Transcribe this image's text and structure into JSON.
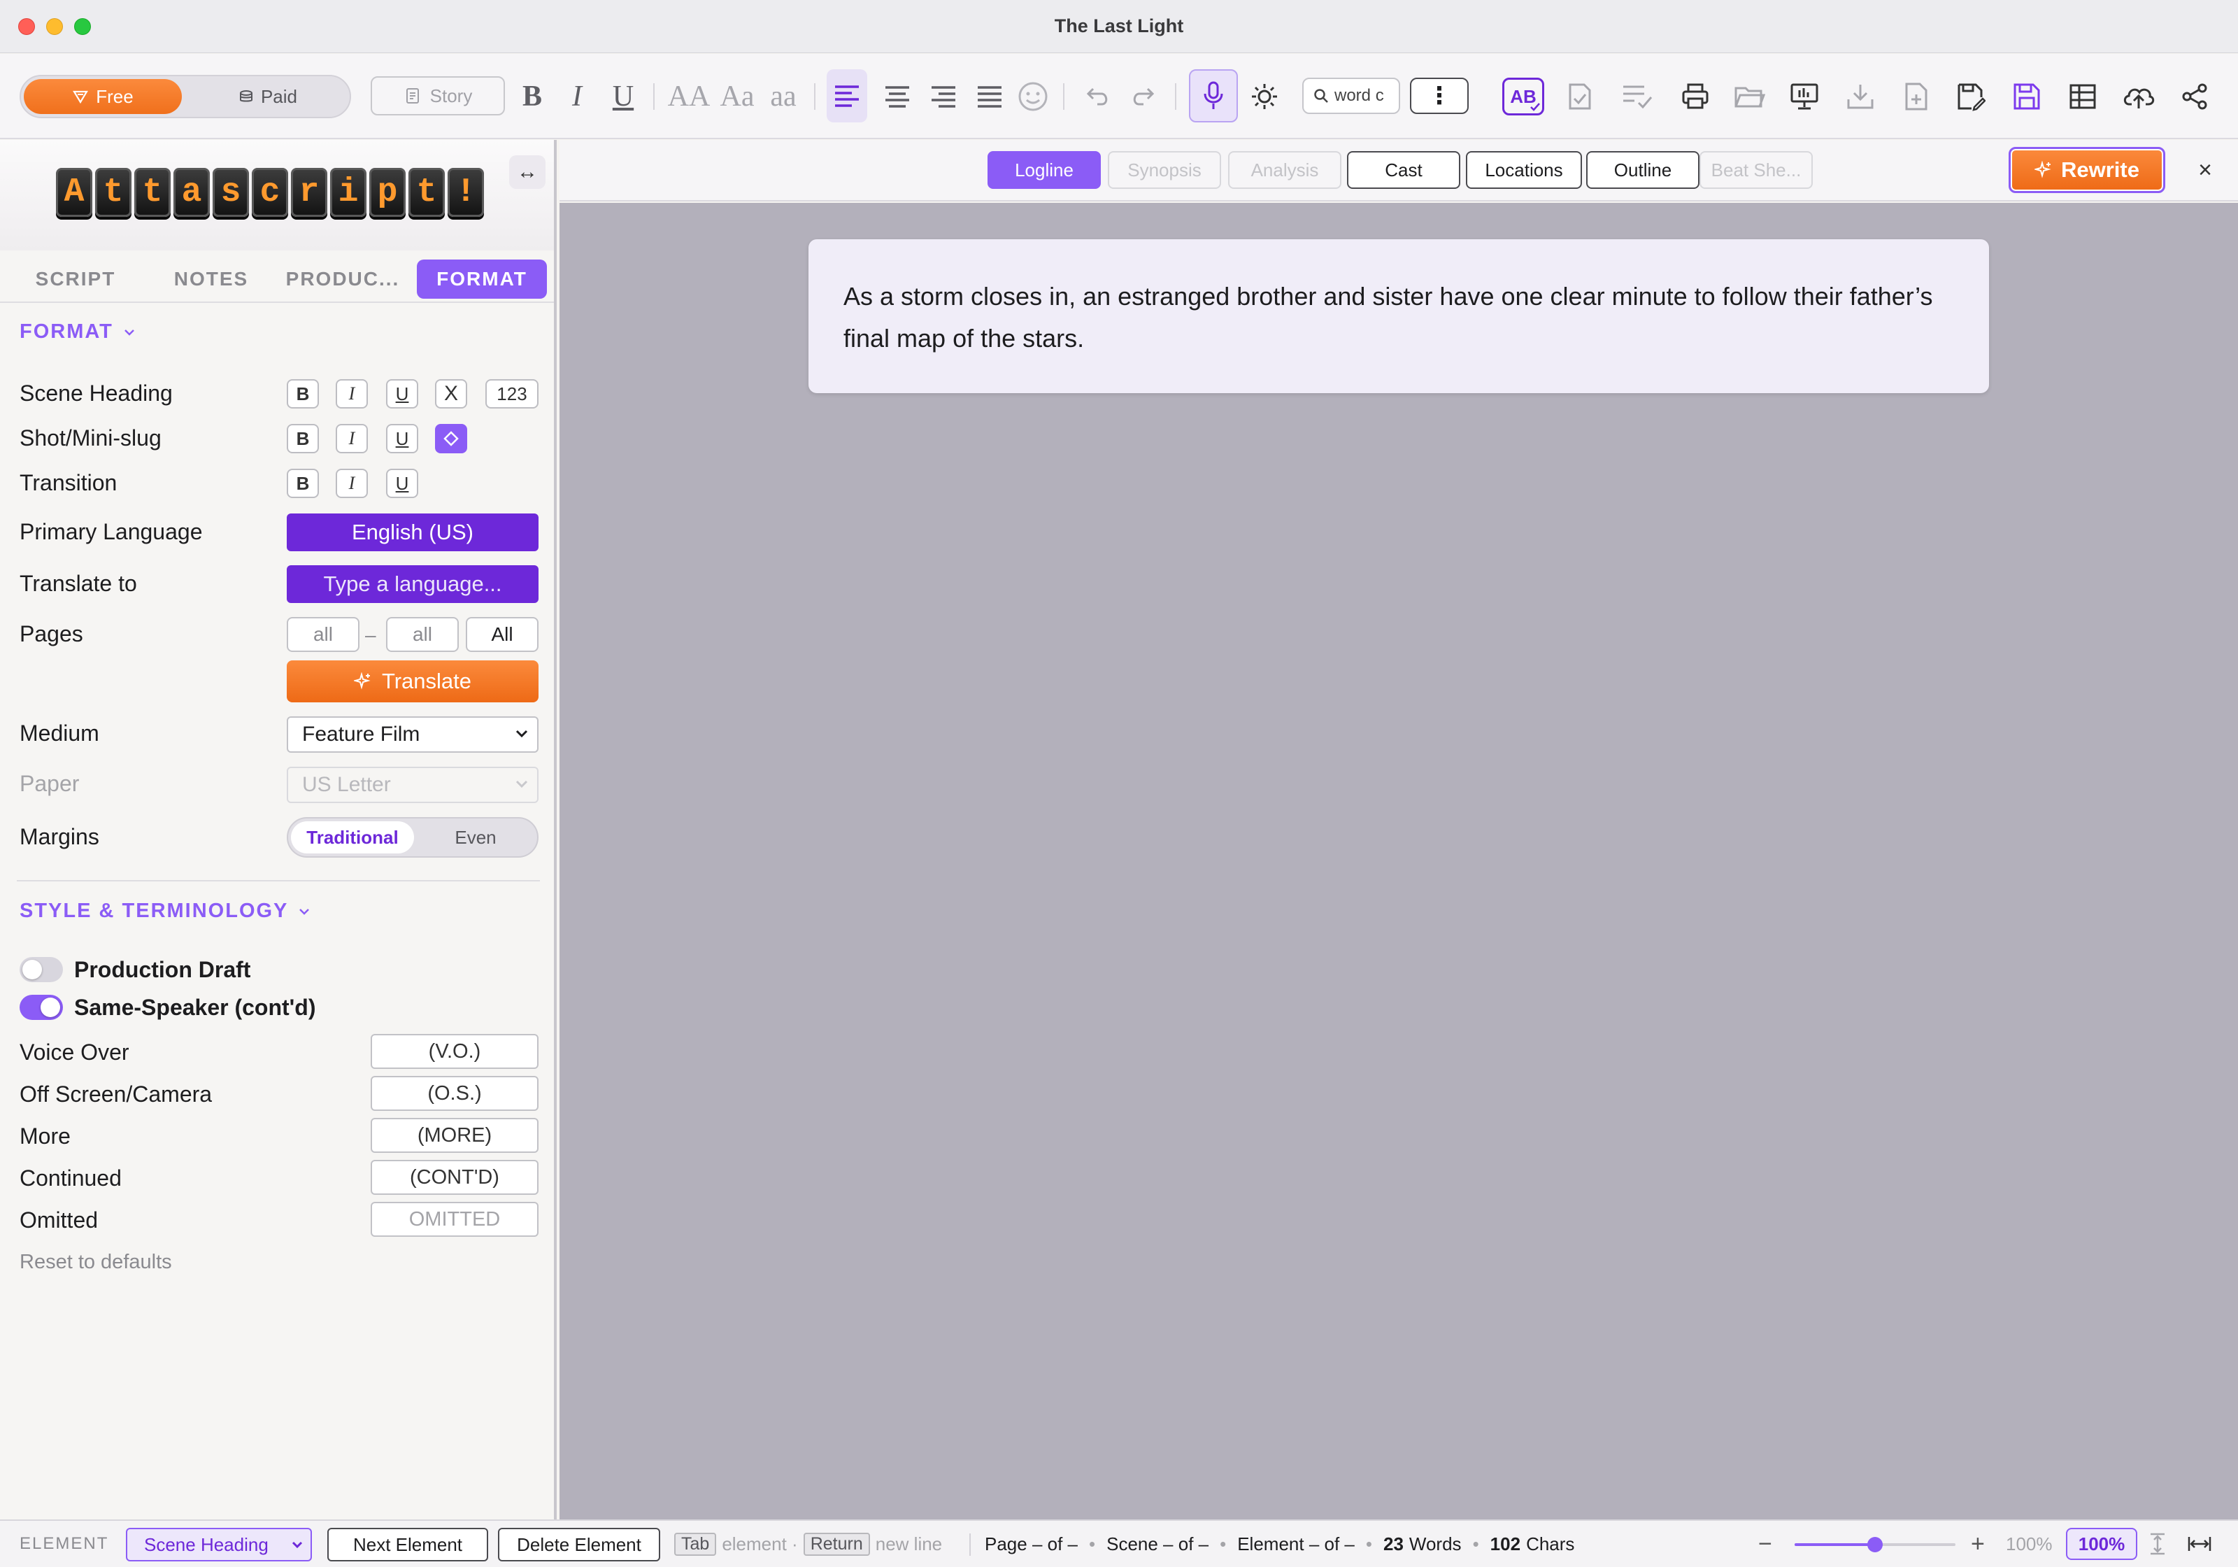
{
  "window": {
    "title": "The Last Light"
  },
  "toolbar": {
    "plan": {
      "free_label": "Free",
      "paid_label": "Paid",
      "selected": "Free"
    },
    "story_label": "Story",
    "bold_glyph": "B",
    "italic_glyph": "I",
    "underline_glyph": "U",
    "case_upper": "AA",
    "case_title": "Aa",
    "case_lower": "aa",
    "search": {
      "value": "word c"
    },
    "more_glyph": "⋮",
    "spellcheck_label": "AB",
    "icons": [
      "smile-icon",
      "undo-icon",
      "redo-icon",
      "microphone-icon",
      "sun-icon",
      "print-icon",
      "folder-icon",
      "present-icon",
      "download-icon",
      "new-file-icon",
      "save-as-icon",
      "save-icon",
      "table-icon",
      "cloud-upload-icon",
      "share-icon"
    ]
  },
  "sidebar": {
    "logo_letters": [
      "A",
      "t",
      "t",
      "a",
      "s",
      "c",
      "r",
      "i",
      "p",
      "t",
      "!"
    ],
    "expand_glyph": "↔",
    "tabs": [
      {
        "label": "SCRIPT",
        "active": false
      },
      {
        "label": "NOTES",
        "active": false
      },
      {
        "label": "PRODUC...",
        "active": false
      },
      {
        "label": "FORMAT",
        "active": true
      }
    ],
    "format_section": {
      "title": "FORMAT",
      "rows": [
        {
          "label": "Scene Heading",
          "b": "B",
          "i": "I",
          "u": "U",
          "x": "X",
          "num": "123"
        },
        {
          "label": "Shot/Mini-slug",
          "b": "B",
          "i": "I",
          "u": "U"
        },
        {
          "label": "Transition",
          "b": "B",
          "i": "I",
          "u": "U"
        }
      ],
      "primary_language": {
        "label": "Primary Language",
        "value": "English (US)"
      },
      "translate_to": {
        "label": "Translate to",
        "placeholder": "Type a language..."
      },
      "pages": {
        "label": "Pages",
        "from_placeholder": "all",
        "dash": "–",
        "to_placeholder": "all",
        "all_label": "All"
      },
      "translate_button": "Translate",
      "medium": {
        "label": "Medium",
        "value": "Feature Film"
      },
      "paper": {
        "label": "Paper",
        "value": "US Letter"
      },
      "margins": {
        "label": "Margins",
        "options": [
          "Traditional",
          "Even"
        ],
        "selected": "Traditional"
      }
    },
    "style_section": {
      "title": "STYLE & TERMINOLOGY",
      "toggles": [
        {
          "label": "Production Draft",
          "on": false
        },
        {
          "label": "Same-Speaker (cont'd)",
          "on": true
        }
      ],
      "terms": [
        {
          "label": "Voice Over",
          "value": "(V.O.)"
        },
        {
          "label": "Off Screen/Camera",
          "value": "(O.S.)"
        },
        {
          "label": "More",
          "value": "(MORE)"
        },
        {
          "label": "Continued",
          "value": "(CONT'D)"
        },
        {
          "label": "Omitted",
          "value": "OMITTED"
        }
      ],
      "reset_label": "Reset to defaults"
    }
  },
  "story_tabs": [
    {
      "label": "Logline",
      "state": "active"
    },
    {
      "label": "Synopsis",
      "state": "disabled"
    },
    {
      "label": "Analysis",
      "state": "disabled"
    },
    {
      "label": "Cast",
      "state": "normal"
    },
    {
      "label": "Locations",
      "state": "normal"
    },
    {
      "label": "Outline",
      "state": "normal"
    },
    {
      "label": "Beat She...",
      "state": "disabled"
    }
  ],
  "rewrite_label": "Rewrite",
  "close_glyph": "×",
  "logline": "As a storm closes in, an estranged brother and sister have one clear minute to follow their father’s final map of the stars.",
  "statusbar": {
    "element_label": "ELEMENT",
    "element_value": "Scene Heading",
    "next_label": "Next Element",
    "delete_label": "Delete Element",
    "tab_key": "Tab",
    "tab_hint": "element ·",
    "return_key": "Return",
    "return_hint": "new line",
    "page": "Page – of –",
    "scene": "Scene – of –",
    "element": "Element – of –",
    "words_count": "23",
    "words_label": "Words",
    "chars_count": "102",
    "chars_label": "Chars",
    "zoom_minus": "−",
    "zoom_plus": "+",
    "zoom_text": "100%",
    "zoom_value": "100%",
    "zoom_fraction": 0.5
  },
  "colors": {
    "accent": "#8b5cf6",
    "accent_dark": "#6d28d9",
    "orange": "#f0701c",
    "canvas": "#b3b0bb"
  }
}
